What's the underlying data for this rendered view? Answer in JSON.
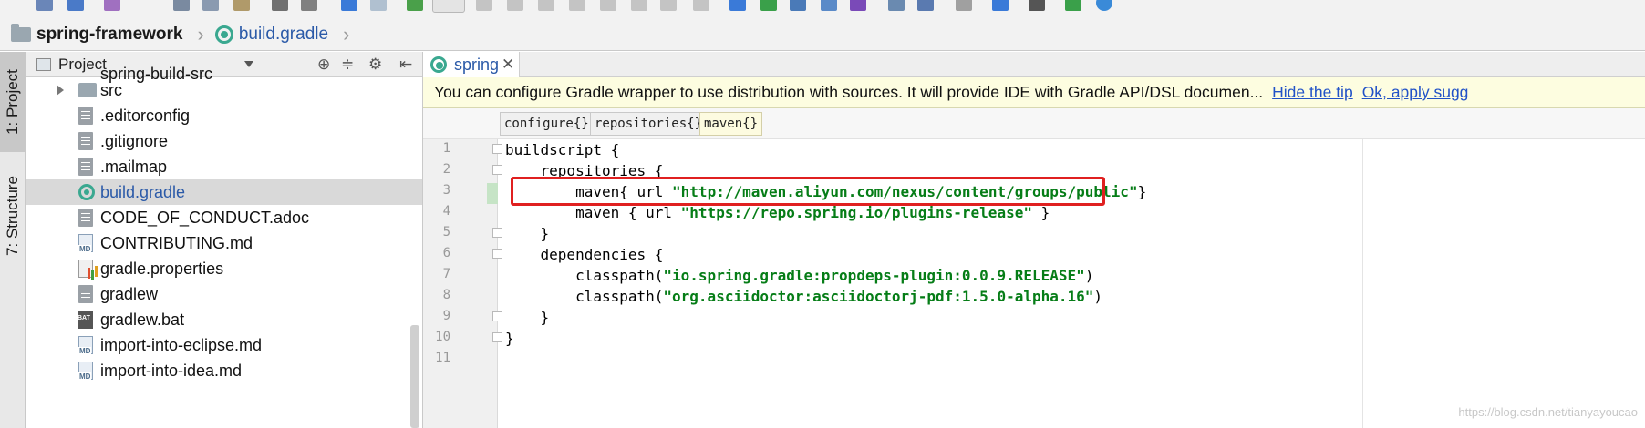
{
  "toolbar": {
    "icons": [
      "save-icon",
      "sync-icon",
      "cut-icon",
      "copy-icon",
      "paste-icon",
      "find-icon",
      "replace-icon",
      "back-icon",
      "forward-icon",
      "build-icon",
      "run-config-dropdown",
      "run-icon",
      "debug-icon",
      "coverage-icon",
      "profile-icon",
      "stop-icon",
      "vcs-update-icon",
      "vcs-commit-icon",
      "project-structure-icon",
      "settings-icon",
      "help-icon"
    ]
  },
  "breadcrumb": {
    "project": "spring-framework",
    "file": "build.gradle"
  },
  "side_strip": {
    "project_tab": "1: Project",
    "structure_tab": "7: Structure"
  },
  "project_panel": {
    "title": "Project",
    "partial_item": "spring-build-src",
    "items": [
      {
        "label": "src",
        "type": "folder"
      },
      {
        "label": ".editorconfig",
        "type": "file"
      },
      {
        "label": ".gitignore",
        "type": "file"
      },
      {
        "label": ".mailmap",
        "type": "file"
      },
      {
        "label": "build.gradle",
        "type": "gradle",
        "selected": true
      },
      {
        "label": "CODE_OF_CONDUCT.adoc",
        "type": "file"
      },
      {
        "label": "CONTRIBUTING.md",
        "type": "md"
      },
      {
        "label": "gradle.properties",
        "type": "properties"
      },
      {
        "label": "gradlew",
        "type": "file"
      },
      {
        "label": "gradlew.bat",
        "type": "bat"
      },
      {
        "label": "import-into-eclipse.md",
        "type": "md"
      },
      {
        "label": "import-into-idea.md",
        "type": "md"
      }
    ]
  },
  "editor": {
    "tab_label": "spring",
    "notification": {
      "message": "You can configure Gradle wrapper to use distribution with sources. It will provide IDE with Gradle API/DSL documen...",
      "hide_link": "Hide the tip",
      "apply_link": "Ok, apply sugg"
    },
    "code_breadcrumbs": [
      "configure{}",
      "repositories{}",
      "maven{}"
    ],
    "line_numbers": [
      "1",
      "2",
      "3",
      "4",
      "5",
      "6",
      "7",
      "8",
      "9",
      "10",
      "11"
    ],
    "lines": [
      {
        "pre": "buildscript {",
        "str": "",
        "post": ""
      },
      {
        "pre": "    repositories {",
        "str": "",
        "post": ""
      },
      {
        "pre": "        maven{ url ",
        "str": "\"http://maven.aliyun.com/nexus/content/groups/public\"",
        "post": "}"
      },
      {
        "pre": "        maven { url ",
        "str": "\"https://repo.spring.io/plugins-release\"",
        "post": " }"
      },
      {
        "pre": "    }",
        "str": "",
        "post": ""
      },
      {
        "pre": "    dependencies {",
        "str": "",
        "post": ""
      },
      {
        "pre": "        classpath(",
        "str": "\"io.spring.gradle:propdeps-plugin:0.0.9.RELEASE\"",
        "post": ")"
      },
      {
        "pre": "        classpath(",
        "str": "\"org.asciidoctor:asciidoctorj-pdf:1.5.0-alpha.16\"",
        "post": ")"
      },
      {
        "pre": "    }",
        "str": "",
        "post": ""
      },
      {
        "pre": "}",
        "str": "",
        "post": ""
      },
      {
        "pre": "",
        "str": "",
        "post": ""
      }
    ]
  },
  "watermark": "https://blog.csdn.net/tianyayoucao",
  "colors": {
    "string": "#067d17",
    "highlight_box": "#e02020",
    "link": "#2152c7",
    "notification_bg": "#fdfde0"
  }
}
